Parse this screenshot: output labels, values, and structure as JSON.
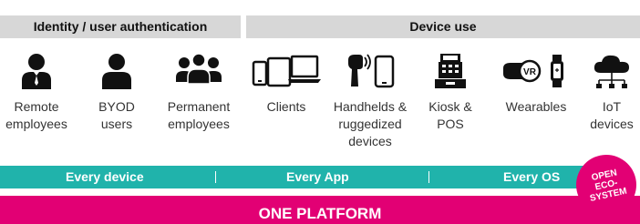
{
  "header": {
    "left": "Identity / user authentication",
    "right": "Device use"
  },
  "items": {
    "remote": [
      "Remote",
      "employees"
    ],
    "byod": [
      "BYOD",
      "users"
    ],
    "permanent": [
      "Permanent",
      "employees"
    ],
    "clients": [
      "Clients"
    ],
    "handhelds": [
      "Handhelds &",
      "ruggedized",
      "devices"
    ],
    "kiosk": [
      "Kiosk &",
      "POS"
    ],
    "wearables": [
      "Wearables"
    ],
    "iot": [
      "IoT",
      "devices"
    ]
  },
  "icons": {
    "remote": "business-person-icon",
    "byod": "person-icon",
    "permanent": "group-of-people-icon",
    "clients": "phone-tablet-laptop-icon",
    "handhelds": "scanner-and-phone-icon",
    "kiosk": "cash-register-icon",
    "wearables": "vr-headset-smartwatch-icon",
    "iot": "cloud-network-icon"
  },
  "vr_text": "VR",
  "bar": {
    "device": "Every device",
    "app": "Every App",
    "os": "Every OS"
  },
  "platform": "ONE PLATFORM",
  "badge": [
    "OPEN",
    "ECO-",
    "SYSTEM"
  ],
  "colors": {
    "teal": "#20b3ab",
    "magenta": "#e20074",
    "header_gray": "#d7d7d7"
  }
}
